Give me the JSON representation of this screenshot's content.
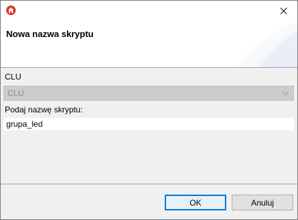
{
  "window": {
    "title_icon": "home-icon",
    "close_icon": "close-icon"
  },
  "header": {
    "title": "Nowa nazwa skryptu"
  },
  "form": {
    "clu_label": "CLU",
    "clu_value": "CLU",
    "clu_disabled": true,
    "name_label": "Podaj nazwę skryptu:",
    "name_value": "grupa_led"
  },
  "buttons": {
    "ok_label": "OK",
    "cancel_label": "Anuluj"
  },
  "colors": {
    "accent": "#0078d7",
    "app_icon": "#d93a2b"
  }
}
